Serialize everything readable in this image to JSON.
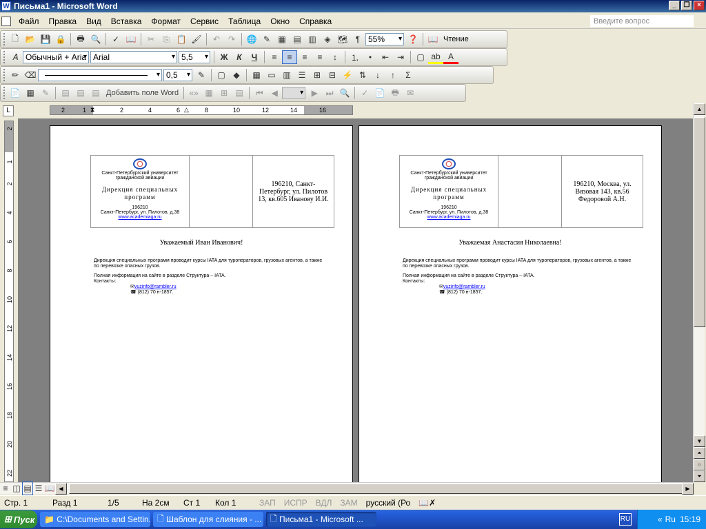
{
  "title": "Письма1 - Microsoft Word",
  "menu": [
    "Файл",
    "Правка",
    "Вид",
    "Вставка",
    "Формат",
    "Сервис",
    "Таблица",
    "Окно",
    "Справка"
  ],
  "ask_placeholder": "Введите вопрос",
  "toolbar1": {
    "zoom": "55%",
    "reading": "Чтение"
  },
  "toolbar2": {
    "style": "Обычный + Aria",
    "font": "Arial",
    "size": "5,5"
  },
  "toolbar3": {
    "line_width": "0,5"
  },
  "toolbar4": {
    "add_field": "Добавить поле Word"
  },
  "ruler_h": [
    "2",
    "1",
    "2",
    "4",
    "6",
    "8",
    "10",
    "12",
    "14",
    "16"
  ],
  "ruler_v": [
    "2",
    "1",
    "2",
    "4",
    "6",
    "8",
    "10",
    "12",
    "14",
    "16",
    "18",
    "20",
    "22"
  ],
  "letterhead": {
    "univ": "Санкт-Петербургский университет гражданской авиации",
    "dir": "Дирекция специальных программ",
    "zip": "196210",
    "addr": "Санкт-Петербург, ул. Пилотов, д.38",
    "link": "www.academiaga.ru"
  },
  "letters": [
    {
      "recipient": "196210, Санкт-Петербург, ул. Пилотов 13, кв.605 Иванову И.И.",
      "greeting": "Уважаемый Иван Иванович!"
    },
    {
      "recipient": "196210, Москва, ул. Вязовая 143, кв.56 Федоровой А.Н.",
      "greeting": "Уважаемая Анастасия Николаевна!"
    }
  ],
  "letter_body": {
    "p1": "Дирекция специальных программ проводит курсы IATA для туроператоров, грузовых агентов, а также по перевозке опасных грузов.",
    "p2": "Полная информация на сайте в разделе Структура – IATA.",
    "contacts": "Контакты:",
    "email": "vuzinfo@rambler.ru",
    "phone": "☎ (812) 70 н-1857."
  },
  "status": {
    "page": "Стр. 1",
    "section": "Разд 1",
    "pages": "1/5",
    "at": "На 2см",
    "line": "Ст 1",
    "col": "Кол 1",
    "rec": "ЗАП",
    "trk": "ИСПР",
    "ext": "ВДЛ",
    "ovr": "ЗАМ",
    "lang": "русский (Ро"
  },
  "taskbar": {
    "start": "Пуск",
    "tasks": [
      "C:\\Documents and Settin...",
      "Шаблон для слияния - ...",
      "Письма1 - Microsoft ..."
    ],
    "lang": "RU",
    "tray_lang": "Ru",
    "time": "15:19"
  }
}
